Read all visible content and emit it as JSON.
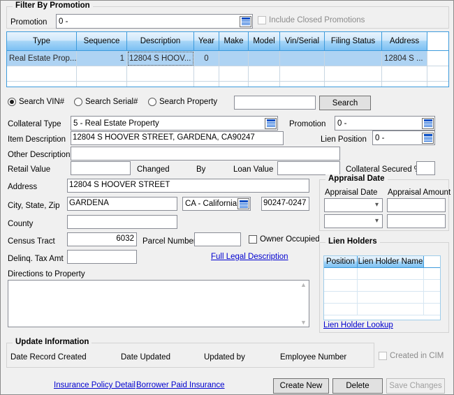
{
  "filter_group": {
    "title": "Filter By Promotion",
    "promotion_label": "Promotion",
    "promotion_value": "0 -",
    "include_closed_label": "Include Closed Promotions"
  },
  "grid": {
    "columns": [
      "Type",
      "Sequence",
      "Description",
      "Year",
      "Make",
      "Model",
      "Vin/Serial",
      "Filing Status",
      "Address"
    ],
    "rows": [
      {
        "Type": "Real Estate Prop...",
        "Sequence": "1",
        "Description": "12804 S HOOV...",
        "Year": "0",
        "Make": "",
        "Model": "",
        "Vin/Serial": "",
        "Filing Status": "",
        "Address": "12804 S ..."
      }
    ]
  },
  "search": {
    "vin_label": "Search VIN#",
    "serial_label": "Search Serial#",
    "property_label": "Search Property",
    "input_value": "",
    "button_label": "Search"
  },
  "detail": {
    "collateral_type_label": "Collateral Type",
    "collateral_type_value": "5 - Real Estate Property",
    "promotion_label": "Promotion",
    "promotion_value": "0 -",
    "item_description_label": "Item Description",
    "item_description_value": "12804 S HOOVER STREET, GARDENA, CA90247",
    "lien_position_label": "Lien Position",
    "lien_position_value": "0 -",
    "other_description_label": "Other Description",
    "other_description_value": "",
    "retail_value_label": "Retail Value",
    "retail_value": "",
    "changed_label": "Changed",
    "by_label": "By",
    "loan_value_label": "Loan Value",
    "loan_value": "",
    "collateral_secured_label": "Collateral Secured %",
    "collateral_secured_value": ""
  },
  "property": {
    "address_label": "Address",
    "address_value": "12804 S HOOVER STREET",
    "city_state_zip_label": "City, State, Zip",
    "city_value": "GARDENA",
    "state_value": "CA - California",
    "zip_value": "90247-0247",
    "county_label": "County",
    "county_value": "",
    "census_tract_label": "Census Tract",
    "census_tract_value": "6032",
    "parcel_number_label": "Parcel Number",
    "parcel_number_value": "",
    "owner_occupied_label": "Owner Occupied",
    "delinq_tax_label": "Delinq. Tax Amt",
    "delinq_tax_value": "",
    "full_legal_link": "Full Legal Description",
    "directions_label": "Directions to Property",
    "directions_value": ""
  },
  "appraisal": {
    "title": "Appraisal Date",
    "date_label": "Appraisal Date",
    "amount_label": "Appraisal Amount",
    "rows": [
      {
        "date": "",
        "amount": ""
      },
      {
        "date": "",
        "amount": ""
      }
    ]
  },
  "lien_holders": {
    "title": "Lien Holders",
    "columns": [
      "Position",
      "Lien Holder Name"
    ],
    "rows": [
      {
        "Position": "",
        "Lien Holder Name": ""
      },
      {
        "Position": "",
        "Lien Holder Name": ""
      },
      {
        "Position": "",
        "Lien Holder Name": ""
      },
      {
        "Position": "",
        "Lien Holder Name": ""
      },
      {
        "Position": "",
        "Lien Holder Name": ""
      }
    ],
    "lookup_link": "Lien Holder Lookup"
  },
  "update_info": {
    "title": "Update Information",
    "date_record_created_label": "Date Record Created",
    "date_updated_label": "Date Updated",
    "updated_by_label": "Updated by",
    "employee_number_label": "Employee Number",
    "created_in_cim_label": "Created in CIM"
  },
  "footer": {
    "insurance_policy_link": "Insurance Policy Detail",
    "borrower_paid_link": "Borrower Paid Insurance",
    "create_new_label": "Create New",
    "delete_label": "Delete",
    "save_changes_label": "Save Changes"
  },
  "colors": {
    "grid_header_blue": "#7cc0f3",
    "grid_border_blue": "#3d9bdc",
    "selected_row": "#aed3f3",
    "link": "#0000cf",
    "window_bg": "#f0f0f0",
    "lookup_icon_blue": "#1565d8"
  }
}
